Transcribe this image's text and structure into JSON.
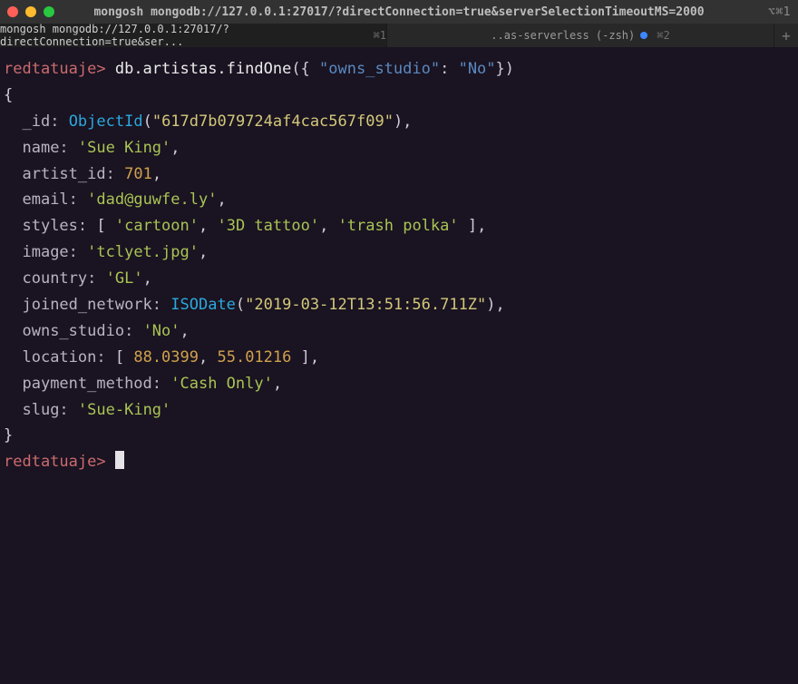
{
  "window": {
    "title": "mongosh mongodb://127.0.0.1:27017/?directConnection=true&serverSelectionTimeoutMS=2000",
    "shortcut": "⌥⌘1"
  },
  "tabs": {
    "left": {
      "label": "mongosh mongodb://127.0.0.1:27017/?directConnection=true&ser...",
      "shortcut": "⌘1"
    },
    "right": {
      "label": "..as-serverless (-zsh)",
      "shortcut": "⌘2"
    },
    "add": "+"
  },
  "terminal": {
    "prompt": "redtatuaje>",
    "cmd": {
      "db": "db.artistas.findOne",
      "key": "\"owns_studio\"",
      "val": "\"No\""
    },
    "obj": {
      "_id_fn": "ObjectId",
      "_id_arg": "\"617d7b079724af4cac567f09\"",
      "name": "'Sue King'",
      "artist_id": "701",
      "email": "'dad@guwfe.ly'",
      "styles": [
        "'cartoon'",
        "'3D tattoo'",
        "'trash polka'"
      ],
      "image": "'tclyet.jpg'",
      "country": "'GL'",
      "joined_fn": "ISODate",
      "joined_arg": "\"2019-03-12T13:51:56.711Z\"",
      "owns_studio": "'No'",
      "location": [
        "88.0399",
        "55.01216"
      ],
      "payment_method": "'Cash Only'",
      "slug": "'Sue-King'"
    }
  }
}
